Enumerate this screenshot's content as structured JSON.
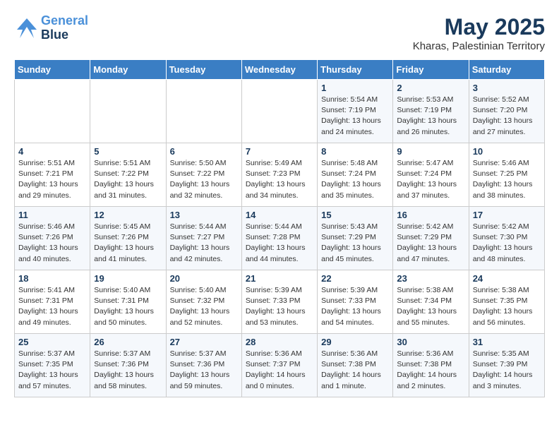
{
  "header": {
    "logo_line1": "General",
    "logo_line2": "Blue",
    "month": "May 2025",
    "location": "Kharas, Palestinian Territory"
  },
  "weekdays": [
    "Sunday",
    "Monday",
    "Tuesday",
    "Wednesday",
    "Thursday",
    "Friday",
    "Saturday"
  ],
  "weeks": [
    [
      {
        "day": "",
        "info": ""
      },
      {
        "day": "",
        "info": ""
      },
      {
        "day": "",
        "info": ""
      },
      {
        "day": "",
        "info": ""
      },
      {
        "day": "1",
        "info": "Sunrise: 5:54 AM\nSunset: 7:19 PM\nDaylight: 13 hours\nand 24 minutes."
      },
      {
        "day": "2",
        "info": "Sunrise: 5:53 AM\nSunset: 7:19 PM\nDaylight: 13 hours\nand 26 minutes."
      },
      {
        "day": "3",
        "info": "Sunrise: 5:52 AM\nSunset: 7:20 PM\nDaylight: 13 hours\nand 27 minutes."
      }
    ],
    [
      {
        "day": "4",
        "info": "Sunrise: 5:51 AM\nSunset: 7:21 PM\nDaylight: 13 hours\nand 29 minutes."
      },
      {
        "day": "5",
        "info": "Sunrise: 5:51 AM\nSunset: 7:22 PM\nDaylight: 13 hours\nand 31 minutes."
      },
      {
        "day": "6",
        "info": "Sunrise: 5:50 AM\nSunset: 7:22 PM\nDaylight: 13 hours\nand 32 minutes."
      },
      {
        "day": "7",
        "info": "Sunrise: 5:49 AM\nSunset: 7:23 PM\nDaylight: 13 hours\nand 34 minutes."
      },
      {
        "day": "8",
        "info": "Sunrise: 5:48 AM\nSunset: 7:24 PM\nDaylight: 13 hours\nand 35 minutes."
      },
      {
        "day": "9",
        "info": "Sunrise: 5:47 AM\nSunset: 7:24 PM\nDaylight: 13 hours\nand 37 minutes."
      },
      {
        "day": "10",
        "info": "Sunrise: 5:46 AM\nSunset: 7:25 PM\nDaylight: 13 hours\nand 38 minutes."
      }
    ],
    [
      {
        "day": "11",
        "info": "Sunrise: 5:46 AM\nSunset: 7:26 PM\nDaylight: 13 hours\nand 40 minutes."
      },
      {
        "day": "12",
        "info": "Sunrise: 5:45 AM\nSunset: 7:26 PM\nDaylight: 13 hours\nand 41 minutes."
      },
      {
        "day": "13",
        "info": "Sunrise: 5:44 AM\nSunset: 7:27 PM\nDaylight: 13 hours\nand 42 minutes."
      },
      {
        "day": "14",
        "info": "Sunrise: 5:44 AM\nSunset: 7:28 PM\nDaylight: 13 hours\nand 44 minutes."
      },
      {
        "day": "15",
        "info": "Sunrise: 5:43 AM\nSunset: 7:29 PM\nDaylight: 13 hours\nand 45 minutes."
      },
      {
        "day": "16",
        "info": "Sunrise: 5:42 AM\nSunset: 7:29 PM\nDaylight: 13 hours\nand 47 minutes."
      },
      {
        "day": "17",
        "info": "Sunrise: 5:42 AM\nSunset: 7:30 PM\nDaylight: 13 hours\nand 48 minutes."
      }
    ],
    [
      {
        "day": "18",
        "info": "Sunrise: 5:41 AM\nSunset: 7:31 PM\nDaylight: 13 hours\nand 49 minutes."
      },
      {
        "day": "19",
        "info": "Sunrise: 5:40 AM\nSunset: 7:31 PM\nDaylight: 13 hours\nand 50 minutes."
      },
      {
        "day": "20",
        "info": "Sunrise: 5:40 AM\nSunset: 7:32 PM\nDaylight: 13 hours\nand 52 minutes."
      },
      {
        "day": "21",
        "info": "Sunrise: 5:39 AM\nSunset: 7:33 PM\nDaylight: 13 hours\nand 53 minutes."
      },
      {
        "day": "22",
        "info": "Sunrise: 5:39 AM\nSunset: 7:33 PM\nDaylight: 13 hours\nand 54 minutes."
      },
      {
        "day": "23",
        "info": "Sunrise: 5:38 AM\nSunset: 7:34 PM\nDaylight: 13 hours\nand 55 minutes."
      },
      {
        "day": "24",
        "info": "Sunrise: 5:38 AM\nSunset: 7:35 PM\nDaylight: 13 hours\nand 56 minutes."
      }
    ],
    [
      {
        "day": "25",
        "info": "Sunrise: 5:37 AM\nSunset: 7:35 PM\nDaylight: 13 hours\nand 57 minutes."
      },
      {
        "day": "26",
        "info": "Sunrise: 5:37 AM\nSunset: 7:36 PM\nDaylight: 13 hours\nand 58 minutes."
      },
      {
        "day": "27",
        "info": "Sunrise: 5:37 AM\nSunset: 7:36 PM\nDaylight: 13 hours\nand 59 minutes."
      },
      {
        "day": "28",
        "info": "Sunrise: 5:36 AM\nSunset: 7:37 PM\nDaylight: 14 hours\nand 0 minutes."
      },
      {
        "day": "29",
        "info": "Sunrise: 5:36 AM\nSunset: 7:38 PM\nDaylight: 14 hours\nand 1 minute."
      },
      {
        "day": "30",
        "info": "Sunrise: 5:36 AM\nSunset: 7:38 PM\nDaylight: 14 hours\nand 2 minutes."
      },
      {
        "day": "31",
        "info": "Sunrise: 5:35 AM\nSunset: 7:39 PM\nDaylight: 14 hours\nand 3 minutes."
      }
    ]
  ]
}
